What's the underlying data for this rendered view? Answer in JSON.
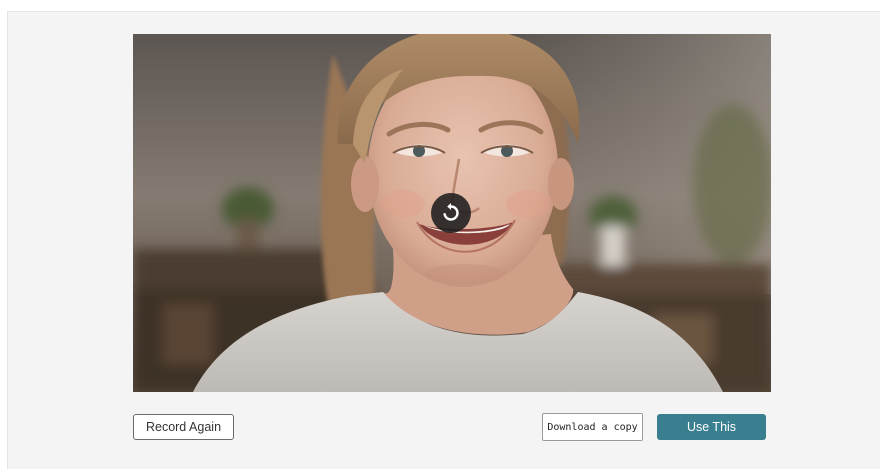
{
  "video": {
    "icon": "replay-icon",
    "overlay_color": "#1e1e1e"
  },
  "actions": {
    "record_again_label": "Record Again",
    "download_label": "Download a copy",
    "use_this_label": "Use This"
  },
  "colors": {
    "primary": "#3a7f90",
    "panel_background": "#f4f4f4"
  }
}
